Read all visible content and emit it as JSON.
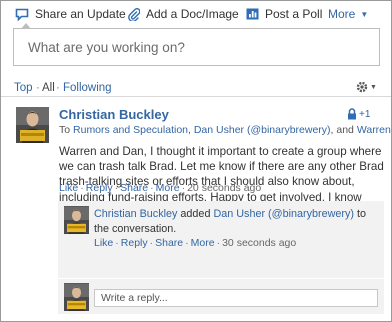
{
  "publisher": {
    "tabs": [
      {
        "label": "Share an Update"
      },
      {
        "label": "Add a Doc/Image"
      },
      {
        "label": "Post a Poll"
      },
      {
        "label": "More"
      }
    ],
    "placeholder": "What are you working on?"
  },
  "filters": {
    "top": "Top",
    "all": "All",
    "following": "Following",
    "separator": "·"
  },
  "post": {
    "author": "Christian Buckley",
    "badge_text": "+1",
    "to_prefix": "To",
    "recipients": [
      "Rumors and Speculation",
      "Dan Usher (@binarybrewery)",
      "Warren Marks"
    ],
    "recipient_sep": ", ",
    "recipient_last_sep": ", and ",
    "body": "Warren and Dan, I thought it important to create a group where we can trash talk Brad. Let me know if there are any other Brad trash-talking sites or efforts that I should also know about, including fund-raising efforts. Happy to get involved. I know Alistair and Seb will be on board.",
    "actions": {
      "like": "Like",
      "reply": "Reply",
      "share": "Share",
      "more": "More",
      "sep": "·",
      "time": "20 seconds ago"
    }
  },
  "activity": {
    "actor": "Christian Buckley",
    "verb": "added",
    "target": "Dan Usher (@binarybrewery)",
    "suffix": "to the conversation.",
    "actions": {
      "like": "Like",
      "reply": "Reply",
      "share": "Share",
      "more": "More",
      "sep": "·",
      "time": "30 seconds ago"
    }
  },
  "reply": {
    "placeholder": "Write a reply..."
  },
  "colors": {
    "link": "#3366a3",
    "accent_blue": "#2f6db5",
    "nested_bg": "#f2f2f2",
    "avatar_badge_yellow": "#e8b82a"
  }
}
